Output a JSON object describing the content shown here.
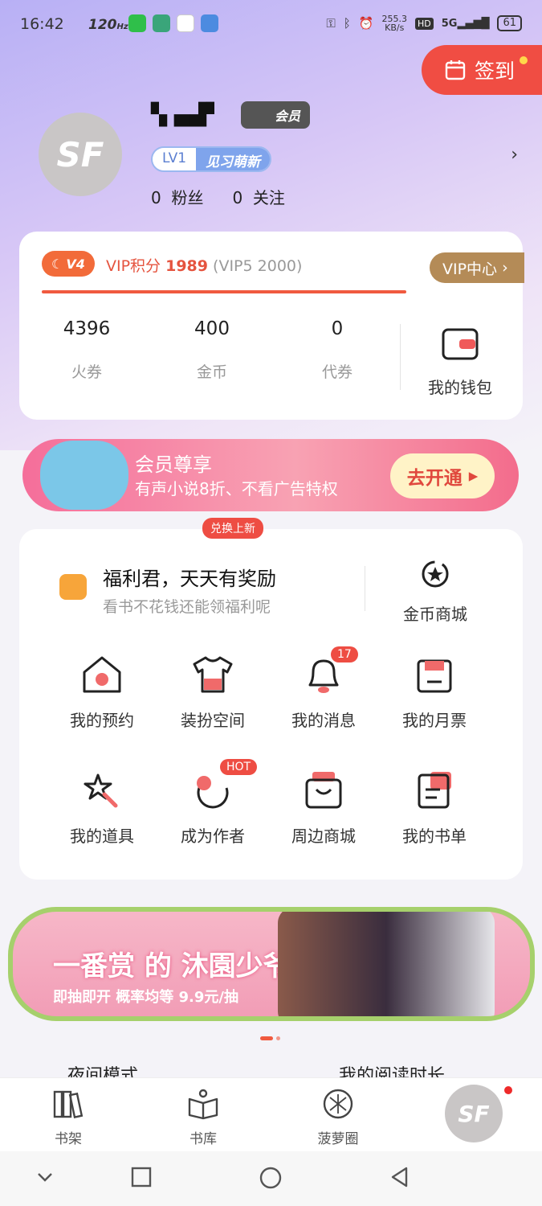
{
  "status": {
    "time": "16:42",
    "hz": "120",
    "speed": "255.3",
    "speed_unit": "KB/s",
    "hd": "HD",
    "net": "5G",
    "battery": "61"
  },
  "signin": {
    "label": "签到"
  },
  "profile": {
    "member_badge": "会员",
    "lv": "LV1",
    "lv_name": "见习萌新",
    "fans_count": "0",
    "fans_label": "粉丝",
    "follow_count": "0",
    "follow_label": "关注",
    "avatar_text": "SF"
  },
  "vip": {
    "icon_text": "V4",
    "score_label": "VIP积分",
    "score": "1989",
    "next": "(VIP5 2000)",
    "center_label": "VIP中心",
    "progress": 0.9945
  },
  "wallet": {
    "stats": [
      {
        "num": "4396",
        "label": "火券"
      },
      {
        "num": "400",
        "label": "金币"
      },
      {
        "num": "0",
        "label": "代券"
      }
    ],
    "my_wallet": "我的钱包"
  },
  "banner1": {
    "title": "会员尊享",
    "sub": "有声小说8折、不看广告特权",
    "btn": "去开通"
  },
  "welfare": {
    "new_tag": "兑换上新",
    "title": "福利君，天天有奖励",
    "sub": "看书不花钱还能领福利呢",
    "shop": "金币商城"
  },
  "grid": [
    {
      "label": "我的预约",
      "icon": "house-clock-icon"
    },
    {
      "label": "装扮空间",
      "icon": "tshirt-icon"
    },
    {
      "label": "我的消息",
      "icon": "bell-icon",
      "badge": "17"
    },
    {
      "label": "我的月票",
      "icon": "ticket-icon"
    },
    {
      "label": "我的道具",
      "icon": "magic-wand-icon"
    },
    {
      "label": "成为作者",
      "icon": "author-icon",
      "badge": "HOT"
    },
    {
      "label": "周边商城",
      "icon": "shopping-bag-icon"
    },
    {
      "label": "我的书单",
      "icon": "book-list-icon"
    }
  ],
  "banner2": {
    "title": "一番赏 的 沐園少爷 啦啦队",
    "sub": "即抽即开 概率均等 9.9元/抽"
  },
  "peek": {
    "left": "夜间模式",
    "right": "我的阅读时长"
  },
  "tabs": [
    {
      "label": "书架"
    },
    {
      "label": "书库"
    },
    {
      "label": "菠萝圈"
    }
  ]
}
